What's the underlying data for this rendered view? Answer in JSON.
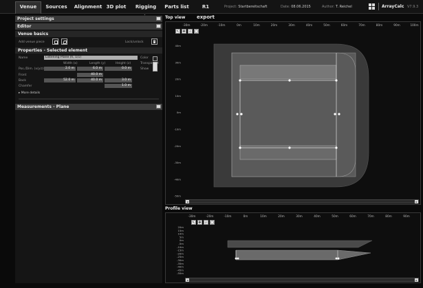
{
  "tabs": [
    "Venue",
    "Sources",
    "Alignment",
    "3D plot",
    "Rigging plot",
    "Parts list",
    "R1 export"
  ],
  "meta": {
    "project_label": "Project:",
    "project_value": "Startbereitschaft",
    "date_label": "Date:",
    "date_value": "08.06.2015",
    "author_label": "Author:",
    "author_value": "T. Reichel",
    "app": "ArrayCalc",
    "version": "V7.9.3"
  },
  "left": {
    "project_settings": "Project settings",
    "editor": "Editor",
    "venue_basics": "Venue basics",
    "add_venue_piece": "Add venue piece",
    "lock_unlock": "Lock/unlock",
    "properties": "Properties - Selected element",
    "name_label": "Name",
    "name_value": "Listening Plane (h, 1/1)",
    "color_label": "Color",
    "transparent": "Transparent",
    "show": "Show",
    "col_width": "Width (x)",
    "col_length": "Length (y)",
    "col_height": "Height (z)",
    "row_pos": "Pos./Dim. (x/y/z)",
    "row_front": "Front",
    "row_back": "Back",
    "row_chamfer": "Chamfer",
    "v_pos_x": "2.0 m",
    "v_pos_y": "6.0 m",
    "v_pos_z": "0.0 m",
    "v_front_y": "40.0 m",
    "v_back_x": "52.0 m",
    "v_back_y": "40.0 m",
    "v_back_z": "3.0 m",
    "v_chamfer": "1.0 m",
    "more_details": "More details",
    "measurements": "Measurements - Plane"
  },
  "top_view": {
    "title": "Top view",
    "x_ticks": [
      "-30m",
      "-20m",
      "-10m",
      "0m",
      "10m",
      "20m",
      "30m",
      "40m",
      "50m",
      "60m",
      "70m",
      "80m",
      "90m",
      "100m"
    ],
    "y_ticks": [
      "40m",
      "30m",
      "20m",
      "10m",
      "0m",
      "-10m",
      "-20m",
      "-30m",
      "-40m",
      "-50m"
    ]
  },
  "profile_view": {
    "title": "Profile view",
    "x_ticks": [
      "-30m",
      "-20m",
      "-10m",
      "0m",
      "10m",
      "20m",
      "30m",
      "40m",
      "50m",
      "60m",
      "70m",
      "80m",
      "90m"
    ],
    "y_ticks": [
      "20m",
      "15m",
      "10m",
      "5m",
      "0m",
      "-5m",
      "-10m",
      "-15m",
      "-20m",
      "-25m",
      "-30m",
      "-35m",
      "-40m",
      "-45m",
      "-50m"
    ]
  },
  "tool_icons": [
    "select-icon",
    "pan-icon",
    "zoom-icon",
    "fit-icon"
  ]
}
